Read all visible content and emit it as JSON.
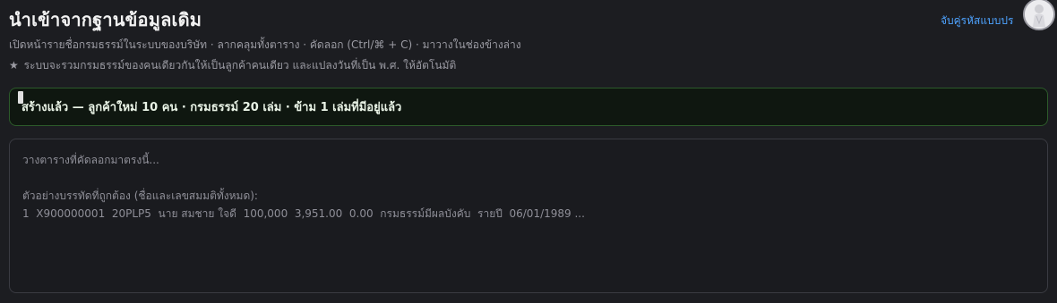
{
  "header": {
    "title": "นำเข้าจากฐานข้อมูลเดิม",
    "link_label": "จับคู่รหัสแบบประ"
  },
  "subtitle": "เปิดหน้ารายชื่อกรมธรรม์ในระบบของบริษัท · ลากคลุมทั้งตาราง · คัดลอก (Ctrl/⌘ + C) · มาวางในช่องข้างล่าง",
  "note": {
    "icon": "star-icon",
    "text": "ระบบจะรวมกรมธรรม์ของคนเดียวกันให้เป็นลูกค้าคนเดียว และแปลงวันที่เป็น พ.ศ. ให้อัตโนมัติ"
  },
  "banner": {
    "text": "สร้างแล้ว — ลูกค้าใหม่ 10 คน · กรมธรรม์ 20 เล่ม · ข้าม 1 เล่มที่มีอยู่แล้ว",
    "status_color": "#2c5a2a"
  },
  "paste_area": {
    "placeholder_line": "วางตารางที่คัดลอกมาตรงนี้...",
    "example_heading": "ตัวอย่างบรรทัดที่ถูกต้อง (ชื่อและเลขสมมติทั้งหมด):",
    "example_row": "1  X900000001  20PLP5  นาย สมชาย ใจดี  100,000  3,951.00  0.00  กรมธรรม์มีผลบังคับ  รายปี  06/01/1989 ..."
  },
  "colors": {
    "background": "#1c1d21",
    "link": "#4ea3ff",
    "muted_text": "#9b9ba3"
  }
}
